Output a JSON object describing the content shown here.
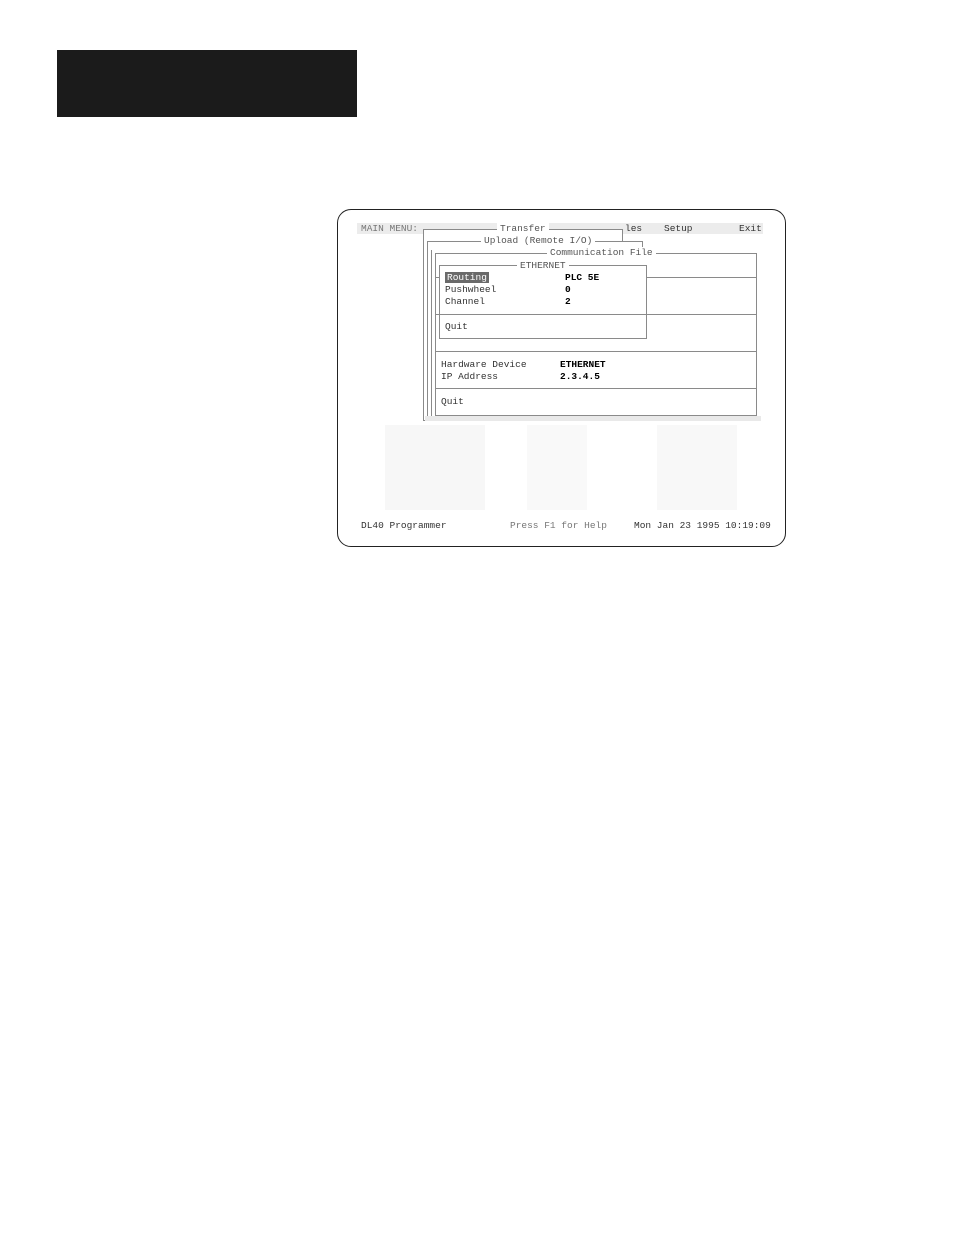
{
  "menu": {
    "main_label": "MAIN MENU:",
    "files_partial": "les",
    "setup": "Setup",
    "exit": "Exit"
  },
  "windows": {
    "transfer_title": "Transfer",
    "upload_title": "Upload (Remote I/O)",
    "comm_file_title": "Communication File",
    "ethernet_title": "ETHERNET"
  },
  "ethernet_panel": {
    "rows": [
      {
        "label": "Routing",
        "value": "PLC 5E"
      },
      {
        "label": "Pushwheel",
        "value": "0"
      },
      {
        "label": "Channel",
        "value": "2"
      }
    ],
    "quit": "Quit"
  },
  "comm_panel": {
    "rows": [
      {
        "label": "Hardware Device",
        "value": "ETHERNET"
      },
      {
        "label": "IP Address",
        "value": "2.3.4.5"
      }
    ],
    "quit": "Quit"
  },
  "status": {
    "app": "DL40 Programmer",
    "help": "Press F1 for Help",
    "datetime": "Mon Jan 23 1995 10:19:09"
  }
}
